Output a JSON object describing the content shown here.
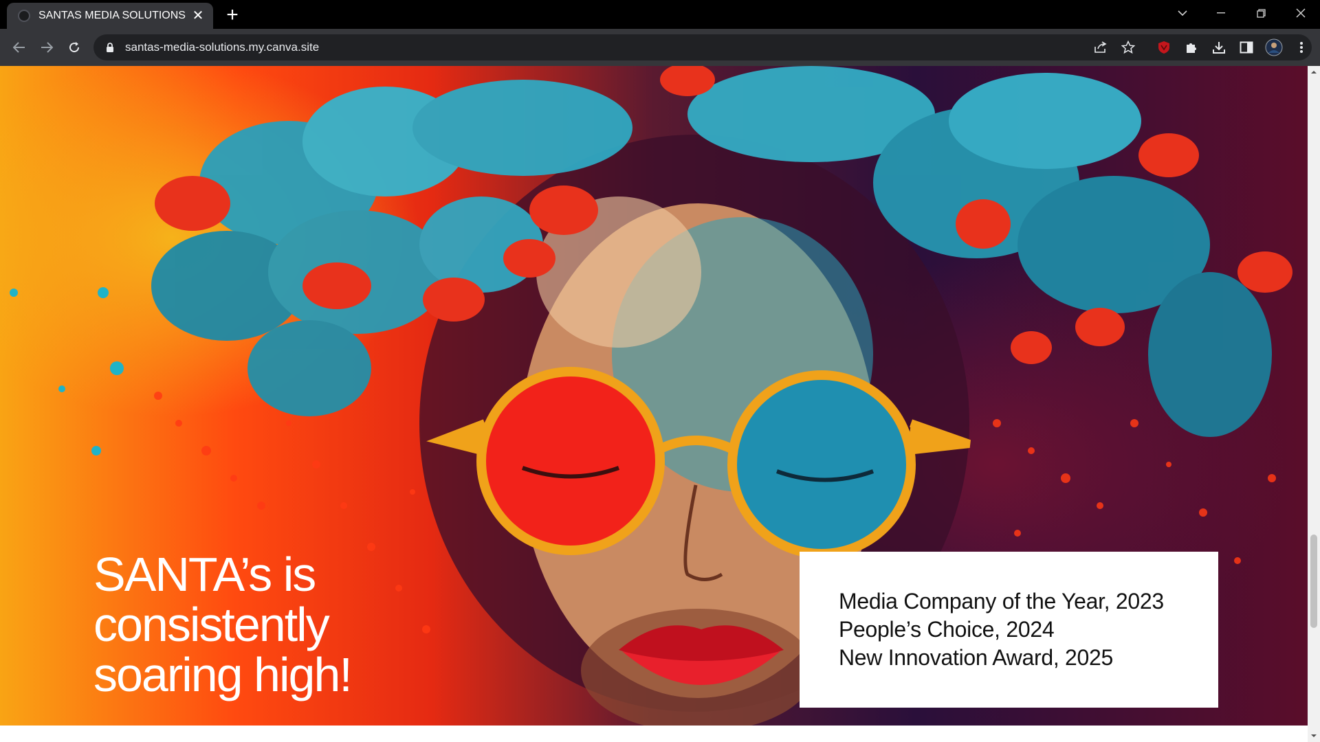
{
  "browser": {
    "tab": {
      "title": "SANTAS MEDIA SOLUTIONS",
      "close": "✕"
    },
    "new_tab": "+",
    "url": "santas-media-solutions.my.canva.site"
  },
  "hero": {
    "headline": [
      "SANTA’s is",
      "consistently",
      "soaring high!"
    ],
    "image": "woman-with-sunglasses-and-flowers"
  },
  "awards": [
    "Media Company of the Year, 2023",
    "People’s Choice, 2024",
    "New Innovation Award, 2025"
  ],
  "colors": {
    "headline_text": "#ffffff",
    "card_background": "#ffffff",
    "card_text": "#111111",
    "browser_frame": "#35363a",
    "omnibox": "#202124"
  },
  "icons": {
    "toolbar": [
      "back-icon",
      "forward-icon",
      "reload-icon",
      "lock-icon",
      "share-icon",
      "star-icon",
      "extension-shield-icon",
      "puzzle-icon",
      "download-icon",
      "side-panel-icon",
      "profile-avatar",
      "menu-dots-icon"
    ]
  }
}
